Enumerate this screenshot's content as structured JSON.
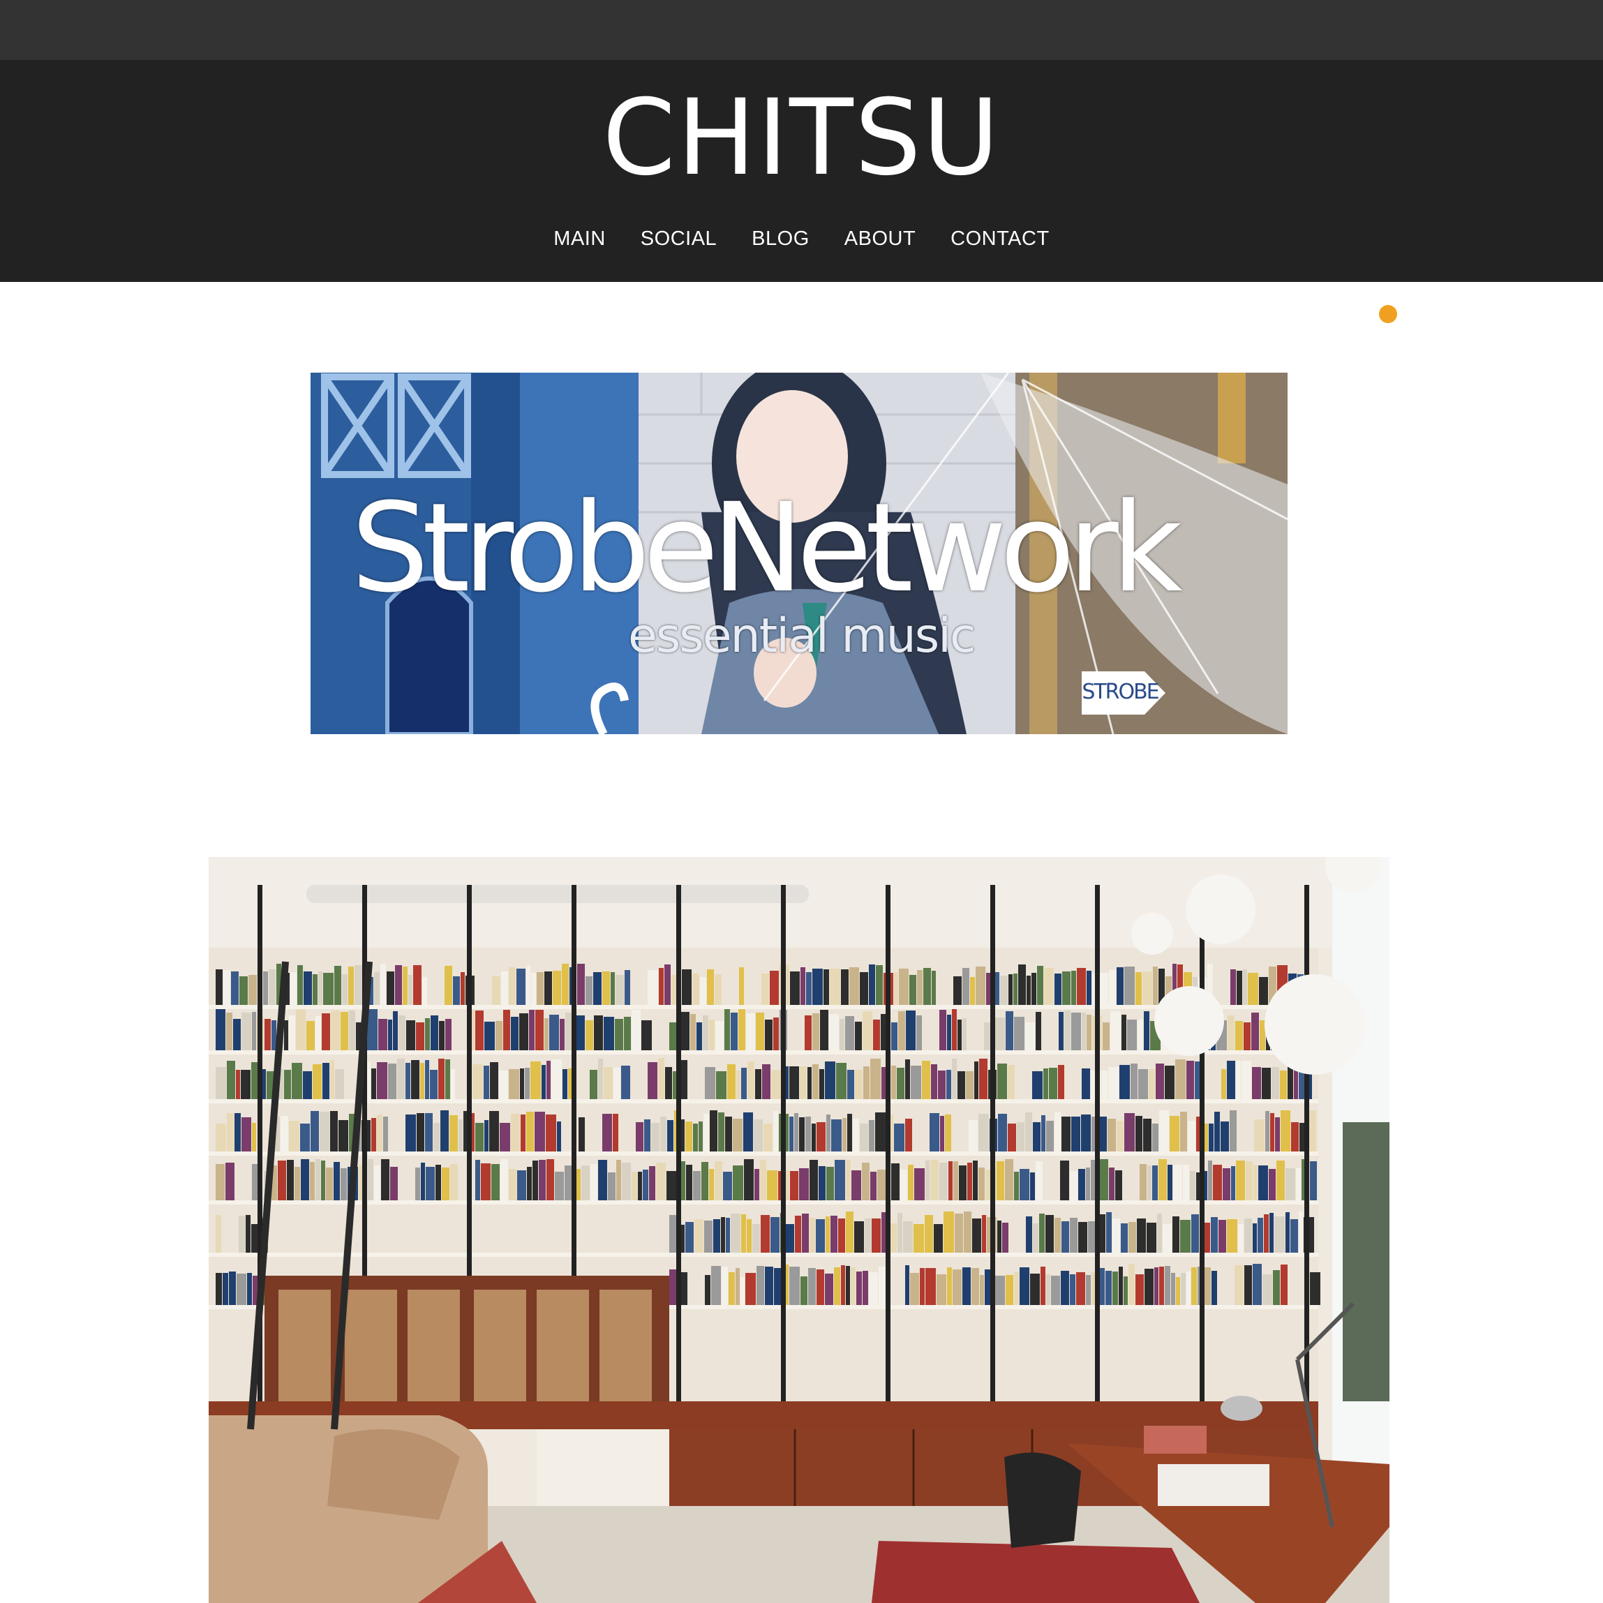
{
  "site": {
    "title": "CHITSU"
  },
  "nav": {
    "items": [
      {
        "label": "MAIN"
      },
      {
        "label": "SOCIAL"
      },
      {
        "label": "BLOG"
      },
      {
        "label": "ABOUT"
      },
      {
        "label": "CONTACT"
      }
    ]
  },
  "colors": {
    "topbar": "#333333",
    "header": "#222222",
    "status_dot": "#f0a020"
  },
  "banner": {
    "title": "StrobeNetwork",
    "subtitle": "essential music",
    "badge": "STROBE"
  },
  "photo": {
    "subject": "library-bookshelf-photo"
  }
}
